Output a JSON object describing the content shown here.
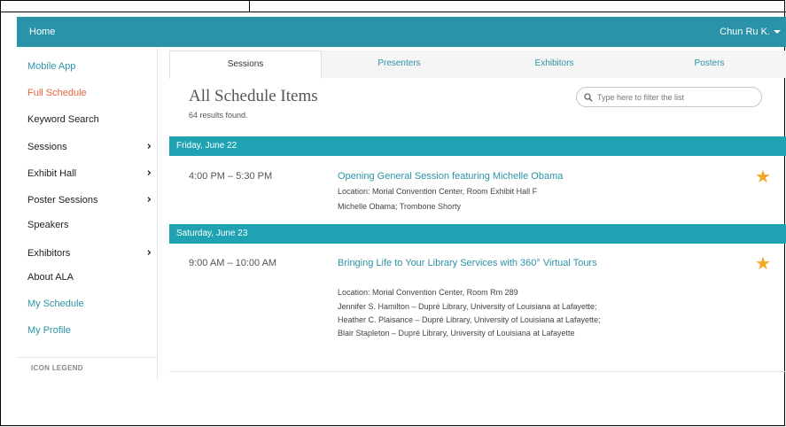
{
  "topbar": {
    "home": "Home",
    "user": "Chun Ru K."
  },
  "sidebar": {
    "items": [
      {
        "label": "Mobile App"
      },
      {
        "label": "Full Schedule"
      },
      {
        "label": "Keyword Search"
      },
      {
        "label": "Sessions"
      },
      {
        "label": "Exhibit Hall"
      },
      {
        "label": "Poster Sessions"
      },
      {
        "label": "Speakers"
      },
      {
        "label": "Exhibitors"
      },
      {
        "label": "About ALA"
      },
      {
        "label": "My Schedule"
      },
      {
        "label": "My Profile"
      }
    ],
    "legend": "ICON LEGEND"
  },
  "tabs": [
    {
      "label": "Sessions"
    },
    {
      "label": "Presenters"
    },
    {
      "label": "Exhibitors"
    },
    {
      "label": "Posters"
    }
  ],
  "main": {
    "title": "All Schedule Items",
    "results": "64 results found.",
    "filter_placeholder": "Type here to filter the list"
  },
  "days": [
    {
      "header": "Friday, June 22",
      "events": [
        {
          "time": "4:00 PM – 5:30 PM",
          "title": "Opening General Session featuring Michelle Obama",
          "location": "Location: Morial Convention Center, Room Exhibit Hall F",
          "people": "Michelle Obama; Trombone Shorty"
        }
      ]
    },
    {
      "header": "Saturday, June 23",
      "events": [
        {
          "time": "9:00 AM – 10:00 AM",
          "title": "Bringing Life to Your Library Services with 360° Virtual Tours",
          "location": "Location: Morial Convention Center, Room Rm 289",
          "people": "Jennifer S. Hamilton – Dupré Library, University of Louisiana at Lafayette; Heather C. Plaisance – Dupré Library, University of Louisiana at Lafayette; Blair Stapleton – Dupré Library, University of Louisiana at Lafayette"
        }
      ]
    }
  ],
  "colors": {
    "accent": "#2a93a8",
    "day_header": "#1fa3b3",
    "star": "#f5a623",
    "active_link": "#e8663d"
  }
}
